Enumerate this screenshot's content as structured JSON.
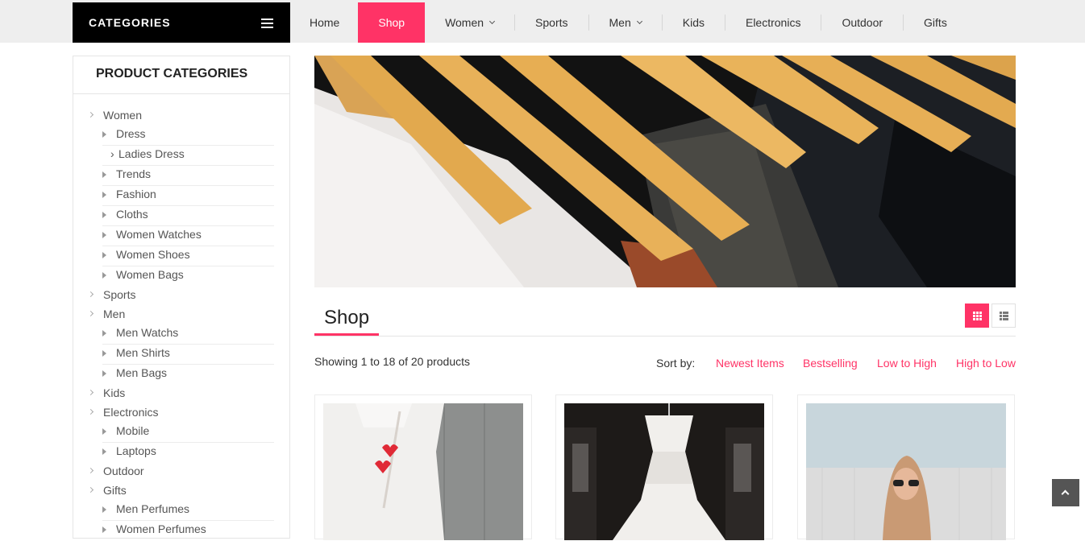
{
  "categories_header": {
    "title": "CATEGORIES"
  },
  "nav": {
    "items": [
      {
        "label": "Home"
      },
      {
        "label": "Shop"
      },
      {
        "label": "Women"
      },
      {
        "label": "Sports"
      },
      {
        "label": "Men"
      },
      {
        "label": "Kids"
      },
      {
        "label": "Electronics"
      },
      {
        "label": "Outdoor"
      },
      {
        "label": "Gifts"
      }
    ],
    "active": "Shop"
  },
  "sidebar": {
    "title": "PRODUCT CATEGORIES",
    "women": "Women",
    "women_subs": [
      "Dress",
      "Ladies Dress",
      "Trends",
      "Fashion",
      "Cloths",
      "Women Watches",
      "Women Shoes",
      "Women Bags"
    ],
    "sports": "Sports",
    "men": "Men",
    "men_subs": [
      "Men Watchs",
      "Men Shirts",
      "Men Bags"
    ],
    "kids": "Kids",
    "electronics": "Electronics",
    "electronics_subs": [
      "Mobile",
      "Laptops"
    ],
    "outdoor": "Outdoor",
    "gifts": "Gifts",
    "gifts_subs": [
      "Men Perfumes",
      "Women Perfumes"
    ]
  },
  "main": {
    "title": "Shop",
    "showing": "Showing 1 to 18 of 20 products",
    "sort_label": "Sort by:",
    "sort_options": [
      "Newest Items",
      "Bestselling",
      "Low to High",
      "High to Low"
    ]
  },
  "colors": {
    "accent": "#ff3366",
    "header_bg": "#000000",
    "nav_bg": "#eeeeee"
  },
  "icons": [
    "menu-icon",
    "grid-view-icon",
    "list-view-icon",
    "chevron-up-icon"
  ]
}
